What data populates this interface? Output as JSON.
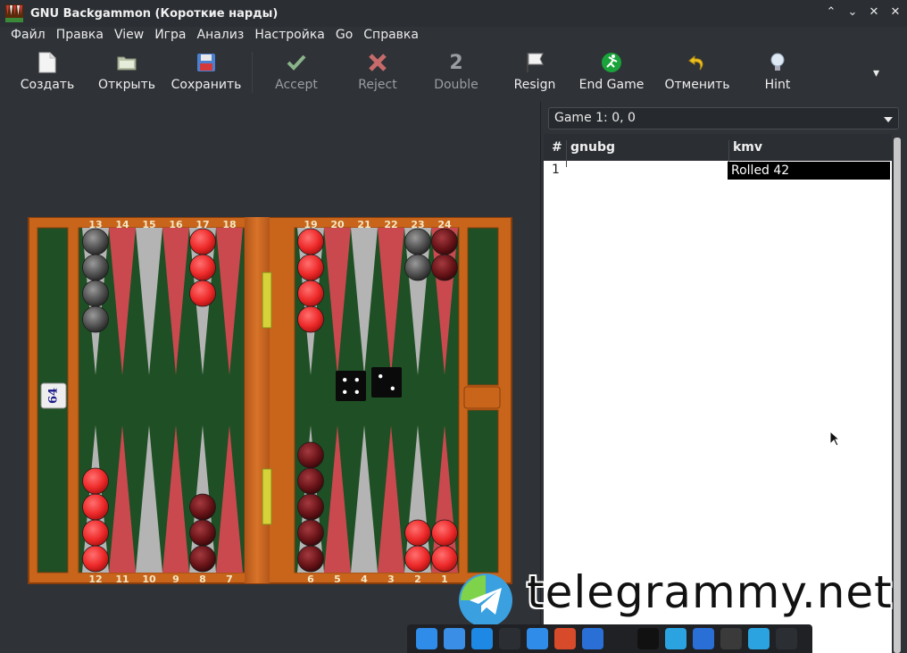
{
  "window": {
    "title": "GNU Backgammon (Короткие нарды)",
    "controls": [
      "⌃",
      "⌄",
      "✕"
    ]
  },
  "menu": [
    "Файл",
    "Правка",
    "View",
    "Игра",
    "Анализ",
    "Настройка",
    "Go",
    "Справка"
  ],
  "toolbar": {
    "buttons": [
      {
        "label": "Создать",
        "enabled": true,
        "icon": "new-document-icon"
      },
      {
        "label": "Открыть",
        "enabled": true,
        "icon": "folder-open-icon"
      },
      {
        "label": "Сохранить",
        "enabled": true,
        "icon": "save-floppy-icon"
      },
      {
        "label": "Accept",
        "enabled": false,
        "icon": "check-icon"
      },
      {
        "label": "Reject",
        "enabled": false,
        "icon": "cross-icon"
      },
      {
        "label": "Double",
        "enabled": false,
        "icon": "double-2-icon"
      },
      {
        "label": "Resign",
        "enabled": true,
        "icon": "flag-icon"
      },
      {
        "label": "End Game",
        "enabled": true,
        "icon": "runner-icon"
      },
      {
        "label": "Отменить",
        "enabled": true,
        "icon": "undo-arrow-icon"
      },
      {
        "label": "Hint",
        "enabled": true,
        "icon": "lightbulb-icon"
      }
    ],
    "overflow_arrow": "▾"
  },
  "board": {
    "top_numbers_left": [
      "13",
      "14",
      "15",
      "16",
      "17",
      "18"
    ],
    "top_numbers_right": [
      "19",
      "20",
      "21",
      "22",
      "23",
      "24"
    ],
    "bottom_numbers_left": [
      "12",
      "11",
      "10",
      "9",
      "8",
      "7"
    ],
    "bottom_numbers_right": [
      "6",
      "5",
      "4",
      "3",
      "2",
      "1"
    ],
    "cube_value": "64",
    "dice": [
      4,
      2
    ],
    "colors": {
      "wood": "#c8651a",
      "felt": "#1f4f24",
      "red_point": "#c9494f",
      "grey_point": "#b4b4b4",
      "red_checker": "#ee2a2a",
      "dark_checker": "#505050",
      "dark_red_checker": "#6a1418"
    },
    "checkers": {
      "13": {
        "color": "dark",
        "count": 4
      },
      "17": {
        "color": "red",
        "count": 3
      },
      "19": {
        "color": "red",
        "count": 4
      },
      "23": {
        "color": "dark",
        "count": 2
      },
      "24": {
        "color": "darkred",
        "count": 2
      },
      "12": {
        "color": "red",
        "count": 4
      },
      "8": {
        "color": "darkred",
        "count": 3
      },
      "6": {
        "color": "darkred",
        "count": 5
      },
      "2": {
        "color": "red",
        "count": 2
      },
      "1": {
        "color": "red",
        "count": 2
      }
    }
  },
  "game_select": {
    "value": "Game 1: 0, 0"
  },
  "movelist": {
    "headers": [
      "#",
      "gnubg",
      "kmv"
    ],
    "rows": [
      {
        "num": "1",
        "gnubg": "",
        "kmv": "Rolled 42"
      }
    ]
  },
  "watermark": {
    "text": "telegrammy.net"
  },
  "taskbar": {
    "apps": [
      {
        "icon": "kde-menu-icon",
        "color": "#2f8ce8"
      },
      {
        "icon": "files-folder-icon",
        "color": "#3a8ee6"
      },
      {
        "icon": "music-app-icon",
        "color": "#1e88e5"
      },
      {
        "icon": "terminal-icon",
        "color": "#2b2e33"
      },
      {
        "icon": "phone-app-icon",
        "color": "#2f8ce8"
      },
      {
        "icon": "mixer-app-icon",
        "color": "#d84b2a"
      },
      {
        "icon": "firefox-icon",
        "color": "#2a6fd6"
      },
      {
        "icon": "chevron-up-icon",
        "color": "#1f2125"
      },
      {
        "icon": "x-twitter-icon",
        "color": "#111111"
      },
      {
        "icon": "telegram-icon",
        "color": "#2aa3e0"
      },
      {
        "icon": "firefox-icon",
        "color": "#2a6fd6"
      },
      {
        "icon": "gnubg-icon",
        "color": "#3a3a3a"
      },
      {
        "icon": "telegram-icon",
        "color": "#2aa3e0"
      },
      {
        "icon": "terminal-icon",
        "color": "#2b2e33"
      }
    ]
  }
}
